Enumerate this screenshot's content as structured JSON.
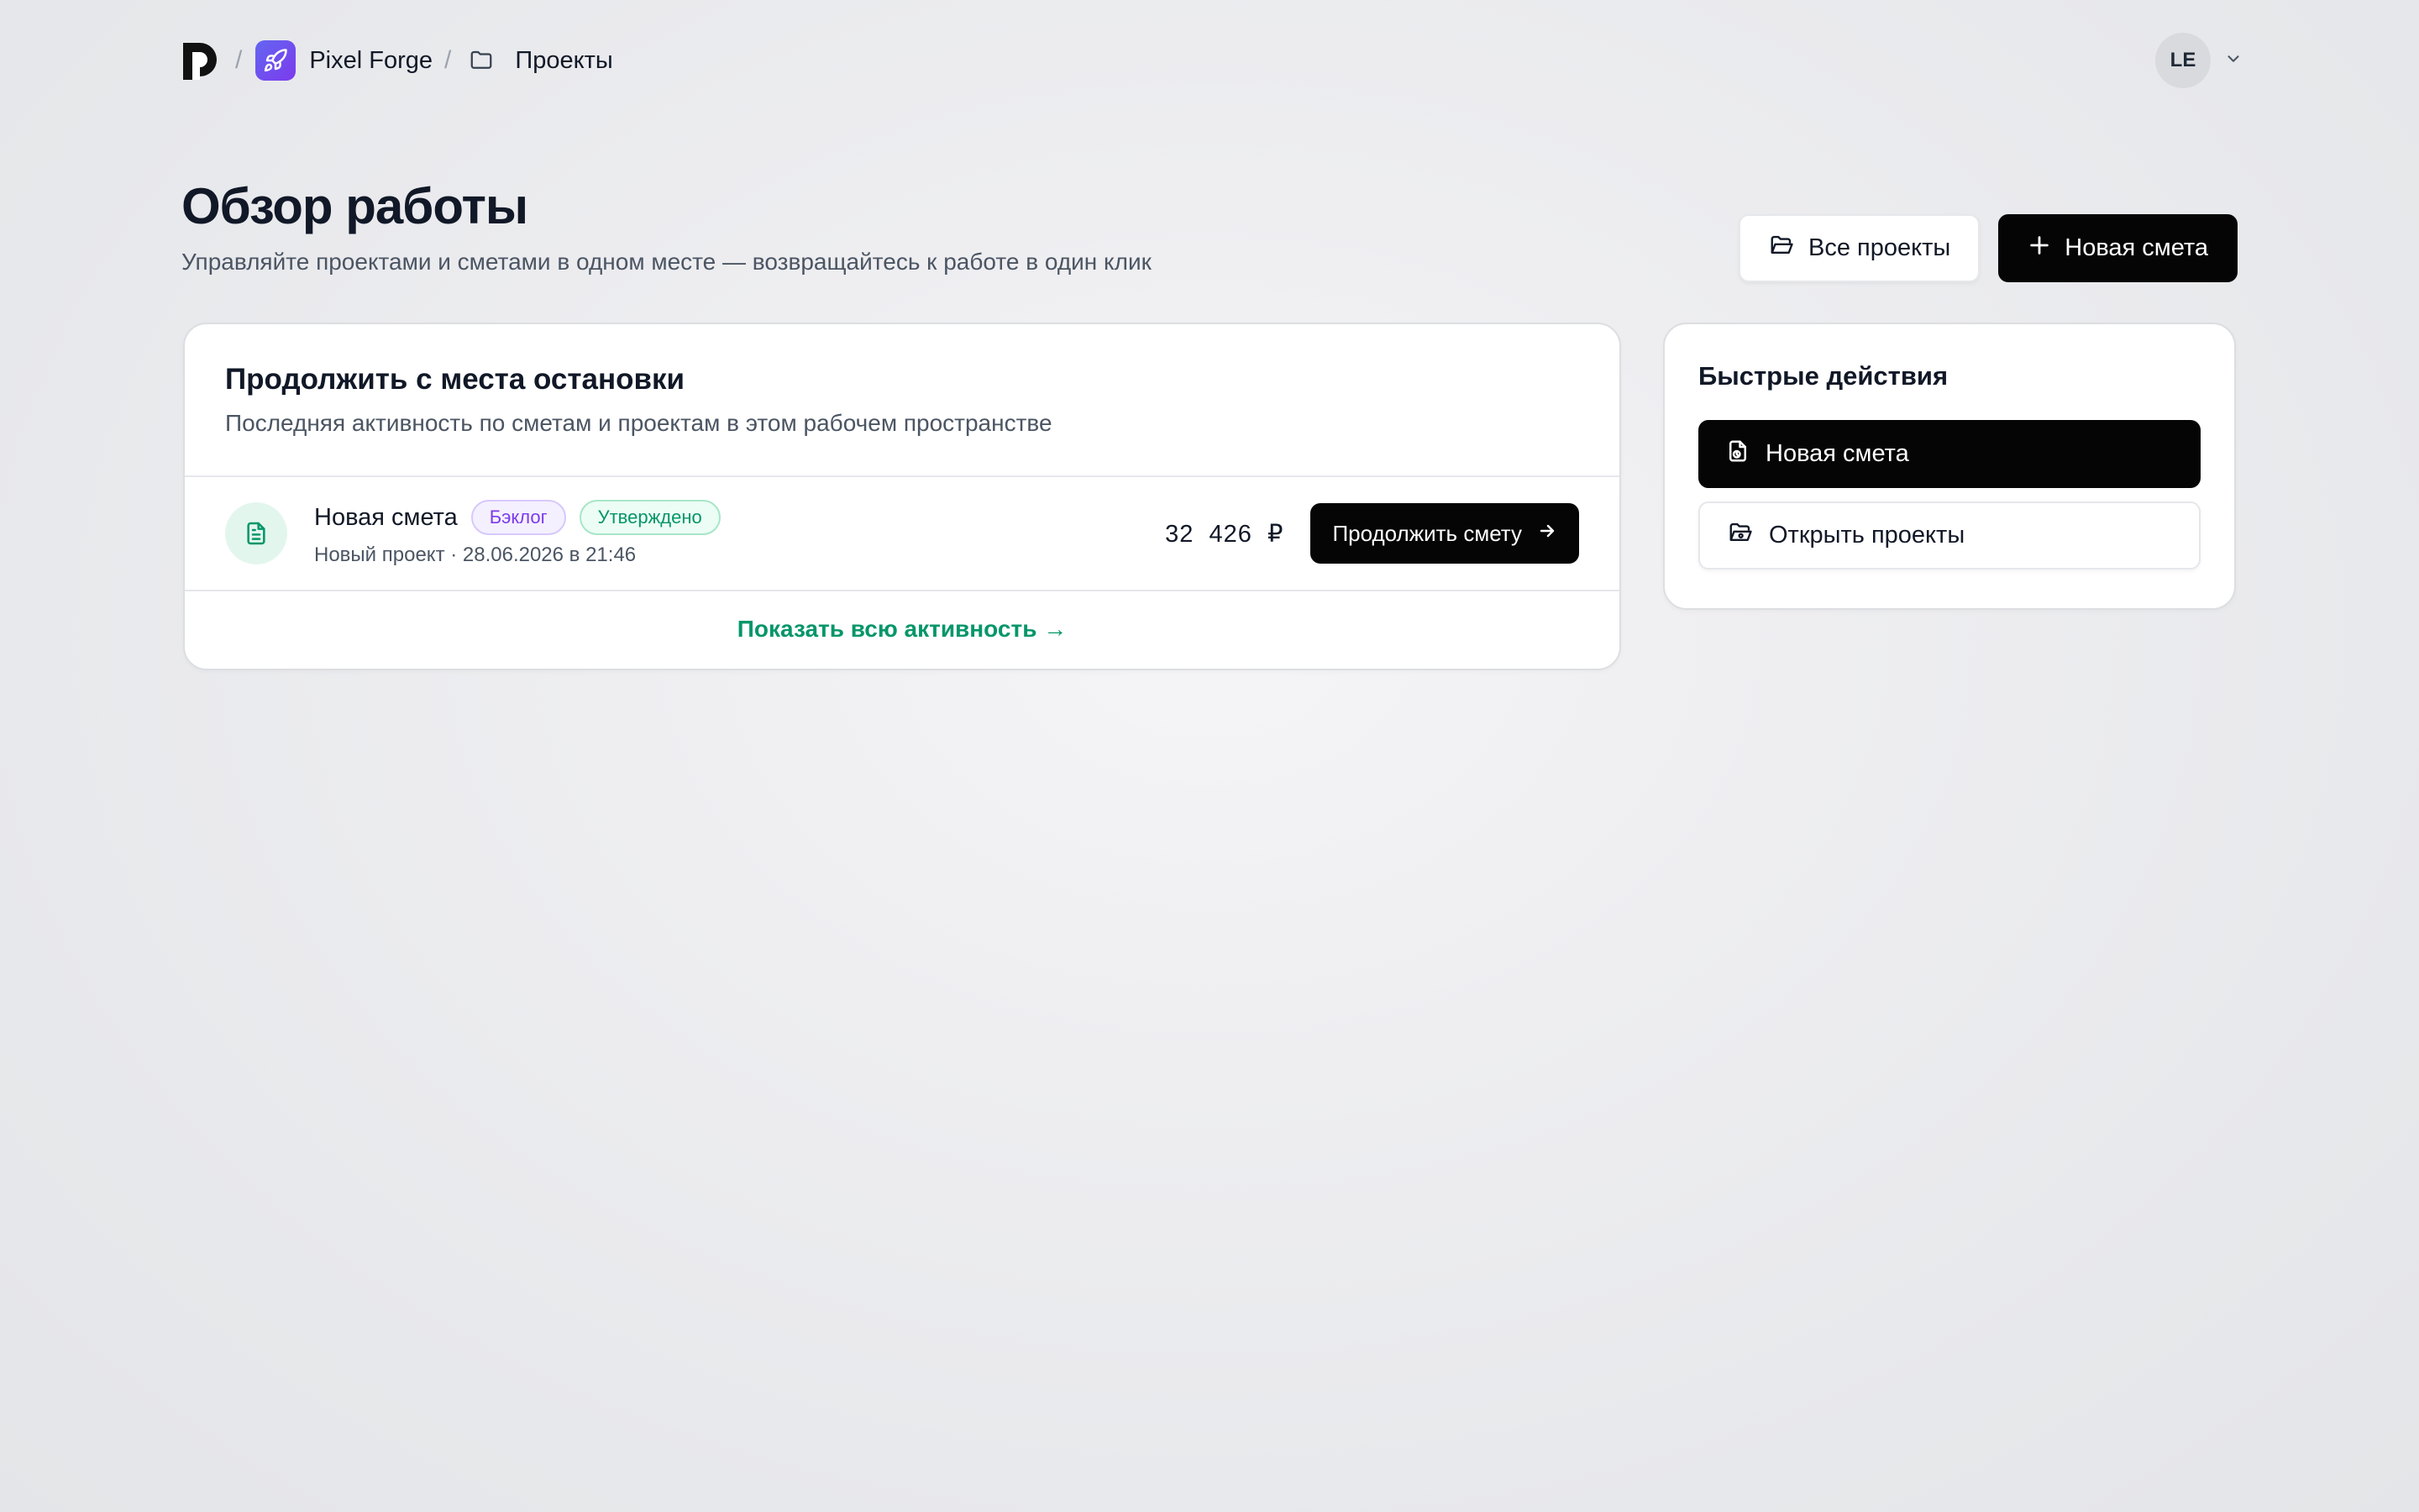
{
  "breadcrumb": {
    "logo_icon": "brand-logo-icon",
    "separator": "/",
    "workspace": "Pixel Forge",
    "workspace_icon": "rocket-icon",
    "section": "Проекты",
    "section_icon": "folder-icon"
  },
  "user": {
    "initials": "LE",
    "menu_icon": "chevron-down-icon"
  },
  "page": {
    "title": "Обзор работы",
    "subtitle": "Управляйте проектами и сметами в одном месте — возвращайтесь к работе в один клик"
  },
  "header_actions": {
    "all_projects": "Все проекты",
    "new_estimate": "Новая смета"
  },
  "continue_card": {
    "title": "Продолжить с места остановки",
    "subtitle": "Последняя активность по сметам и проектам в этом рабочем пространстве",
    "items": [
      {
        "name": "Новая смета",
        "badges": [
          "Бэклог",
          "Утверждено"
        ],
        "meta": "Новый проект · 28.06.2026 в 21:46",
        "amount": "32  426  ₽",
        "action": "Продолжить смету"
      }
    ],
    "show_all": "Показать всю активность →"
  },
  "quick_actions": {
    "title": "Быстрые действия",
    "new_estimate": "Новая смета",
    "open_projects": "Открыть проекты"
  },
  "colors": {
    "accent_green": "#059669",
    "primary_black": "#050505",
    "workspace_purple": "#6366f1",
    "badge_purple": "#7c3aed"
  }
}
